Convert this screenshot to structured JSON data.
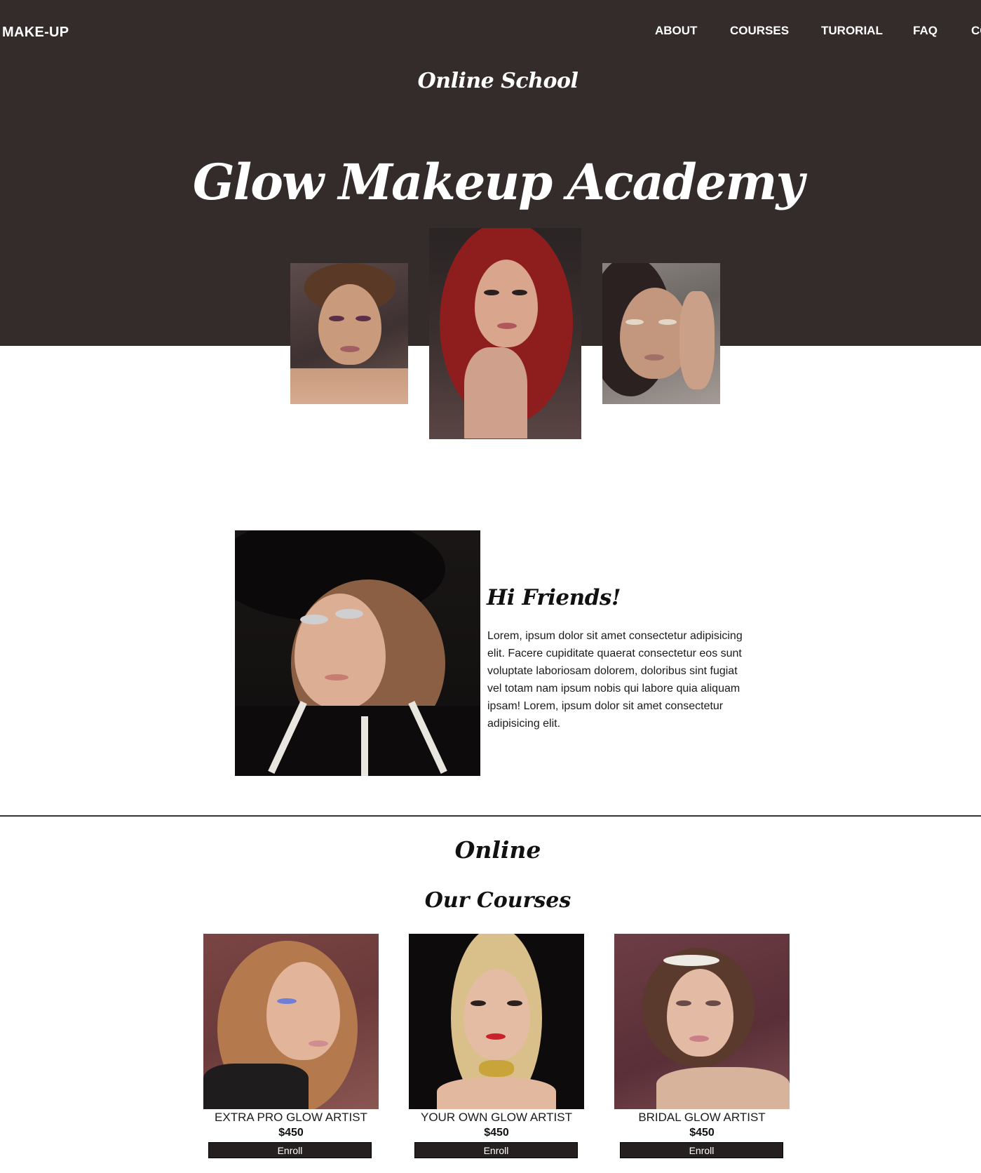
{
  "nav": {
    "logo": "MAKE-UP",
    "links": [
      "ABOUT",
      "COURSES",
      "TURORIAL",
      "FAQ",
      "CONTACT"
    ]
  },
  "hero": {
    "eyebrow": "Online School",
    "title": "Glow Makeup Academy"
  },
  "about": {
    "heading": "Hi Friends!",
    "text": "Lorem, ipsum dolor sit amet consectetur adipisicing elit. Facere cupiditate quaerat consectetur eos sunt voluptate laboriosam dolorem, doloribus sint fugiat vel totam nam ipsum nobis qui labore quia aliquam ipsam! Lorem, ipsum dolor sit amet consectetur adipisicing elit."
  },
  "courses": {
    "eyebrow": "Online",
    "title": "Our Courses",
    "items": [
      {
        "name": "EXTRA PRO GLOW ARTIST",
        "price": "$450",
        "button": "Enroll"
      },
      {
        "name": "YOUR OWN GLOW ARTIST",
        "price": "$450",
        "button": "Enroll"
      },
      {
        "name": "BRIDAL GLOW ARTIST",
        "price": "$450",
        "button": "Enroll"
      }
    ]
  },
  "colors": {
    "hero_background": "#332c2b",
    "button_background": "#251f1f",
    "text_light": "#ffffff"
  }
}
